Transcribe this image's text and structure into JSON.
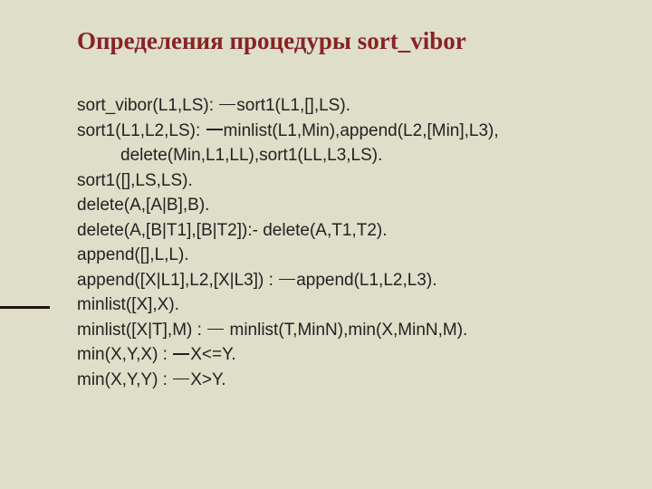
{
  "title": "Определения процедуры sort_vibor",
  "lines": [
    {
      "prefix": "sort_vibor(L1,LS): ",
      "dash": true,
      "suffix": "sort1(L1,[],LS)."
    },
    {
      "prefix": "sort1(L1,L2,LS): ",
      "dash": true,
      "suffix": "minlist(L1,Min),append(L2,[Min],L3),"
    },
    {
      "indent": true,
      "prefix": "delete(Min,L1,LL),sort1(LL,L3,LS).",
      "dash": false,
      "suffix": ""
    },
    {
      "prefix": "sort1([],LS,LS).",
      "dash": false,
      "suffix": ""
    },
    {
      "prefix": "delete(A,[A|B],B).",
      "dash": false,
      "suffix": ""
    },
    {
      "prefix": "delete(A,[B|T1],[B|T2]):- delete(A,T1,T2).",
      "dash": false,
      "suffix": ""
    },
    {
      "prefix": "append([],L,L).",
      "dash": false,
      "suffix": ""
    },
    {
      "prefix": "append([X|L1],L2,[X|L3]) : ",
      "dash": true,
      "suffix": "append(L1,L2,L3)."
    },
    {
      "prefix": "minlist([X],X).",
      "dash": false,
      "suffix": ""
    },
    {
      "prefix": "minlist([X|T],M) : ",
      "dash": true,
      "suffix": " minlist(T,MinN),min(X,MinN,M)."
    },
    {
      "prefix": "min(X,Y,X) : ",
      "dash": true,
      "suffix": "X<=Y."
    },
    {
      "prefix": "min(X,Y,Y) : ",
      "dash": true,
      "suffix": "X>Y."
    }
  ]
}
